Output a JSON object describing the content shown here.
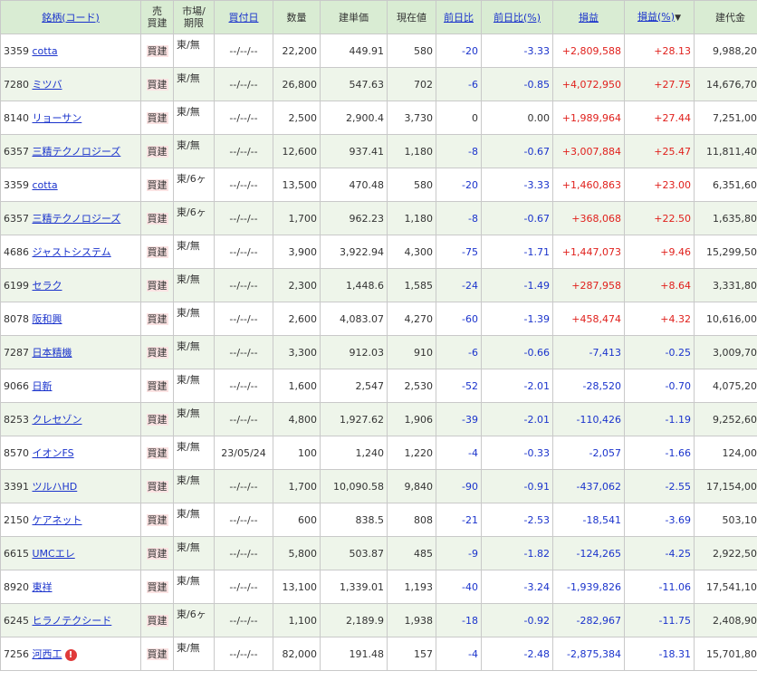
{
  "headers": {
    "name_code": "銘柄(コード)",
    "sell_buy_line1": "売",
    "sell_buy_line2": "買建",
    "market_line1": "市場/",
    "market_line2": "期限",
    "buy_date": "買付日",
    "quantity": "数量",
    "unit_price": "建単価",
    "current_price": "現在値",
    "day_change": "前日比",
    "day_change_pct": "前日比(%)",
    "profit": "損益",
    "profit_pct": "損益(%)",
    "sort_arrow": "▼",
    "position_value": "建代金"
  },
  "rows": [
    {
      "code": "3359",
      "name": "cotta",
      "type": "買建",
      "market": "東/無",
      "date": "--/--/--",
      "qty": "22,200",
      "unit": "449.91",
      "price": "580",
      "chg": "-20",
      "chg_pct": "-3.33",
      "pl": "+2,809,588",
      "pl_pct": "+28.13",
      "value": "9,988,200"
    },
    {
      "code": "7280",
      "name": "ミツバ",
      "type": "買建",
      "market": "東/無",
      "date": "--/--/--",
      "qty": "26,800",
      "unit": "547.63",
      "price": "702",
      "chg": "-6",
      "chg_pct": "-0.85",
      "pl": "+4,072,950",
      "pl_pct": "+27.75",
      "value": "14,676,700"
    },
    {
      "code": "8140",
      "name": "リョーサン",
      "type": "買建",
      "market": "東/無",
      "date": "--/--/--",
      "qty": "2,500",
      "unit": "2,900.4",
      "price": "3,730",
      "chg": "0",
      "chg_pct": "0.00",
      "pl": "+1,989,964",
      "pl_pct": "+27.44",
      "value": "7,251,000"
    },
    {
      "code": "6357",
      "name": "三精テクノロジーズ",
      "type": "買建",
      "market": "東/無",
      "date": "--/--/--",
      "qty": "12,600",
      "unit": "937.41",
      "price": "1,180",
      "chg": "-8",
      "chg_pct": "-0.67",
      "pl": "+3,007,884",
      "pl_pct": "+25.47",
      "value": "11,811,400"
    },
    {
      "code": "3359",
      "name": "cotta",
      "type": "買建",
      "market": "東/6ヶ",
      "date": "--/--/--",
      "qty": "13,500",
      "unit": "470.48",
      "price": "580",
      "chg": "-20",
      "chg_pct": "-3.33",
      "pl": "+1,460,863",
      "pl_pct": "+23.00",
      "value": "6,351,600"
    },
    {
      "code": "6357",
      "name": "三精テクノロジーズ",
      "type": "買建",
      "market": "東/6ヶ",
      "date": "--/--/--",
      "qty": "1,700",
      "unit": "962.23",
      "price": "1,180",
      "chg": "-8",
      "chg_pct": "-0.67",
      "pl": "+368,068",
      "pl_pct": "+22.50",
      "value": "1,635,800"
    },
    {
      "code": "4686",
      "name": "ジャストシステム",
      "type": "買建",
      "market": "東/無",
      "date": "--/--/--",
      "qty": "3,900",
      "unit": "3,922.94",
      "price": "4,300",
      "chg": "-75",
      "chg_pct": "-1.71",
      "pl": "+1,447,073",
      "pl_pct": "+9.46",
      "value": "15,299,500"
    },
    {
      "code": "6199",
      "name": "セラク",
      "type": "買建",
      "market": "東/無",
      "date": "--/--/--",
      "qty": "2,300",
      "unit": "1,448.6",
      "price": "1,585",
      "chg": "-24",
      "chg_pct": "-1.49",
      "pl": "+287,958",
      "pl_pct": "+8.64",
      "value": "3,331,800"
    },
    {
      "code": "8078",
      "name": "阪和興",
      "type": "買建",
      "market": "東/無",
      "date": "--/--/--",
      "qty": "2,600",
      "unit": "4,083.07",
      "price": "4,270",
      "chg": "-60",
      "chg_pct": "-1.39",
      "pl": "+458,474",
      "pl_pct": "+4.32",
      "value": "10,616,000"
    },
    {
      "code": "7287",
      "name": "日本精機",
      "type": "買建",
      "market": "東/無",
      "date": "--/--/--",
      "qty": "3,300",
      "unit": "912.03",
      "price": "910",
      "chg": "-6",
      "chg_pct": "-0.66",
      "pl": "-7,413",
      "pl_pct": "-0.25",
      "value": "3,009,700"
    },
    {
      "code": "9066",
      "name": "日新",
      "type": "買建",
      "market": "東/無",
      "date": "--/--/--",
      "qty": "1,600",
      "unit": "2,547",
      "price": "2,530",
      "chg": "-52",
      "chg_pct": "-2.01",
      "pl": "-28,520",
      "pl_pct": "-0.70",
      "value": "4,075,200"
    },
    {
      "code": "8253",
      "name": "クレセゾン",
      "type": "買建",
      "market": "東/無",
      "date": "--/--/--",
      "qty": "4,800",
      "unit": "1,927.62",
      "price": "1,906",
      "chg": "-39",
      "chg_pct": "-2.01",
      "pl": "-110,426",
      "pl_pct": "-1.19",
      "value": "9,252,600"
    },
    {
      "code": "8570",
      "name": "イオンFS",
      "type": "買建",
      "market": "東/無",
      "date": "23/05/24",
      "qty": "100",
      "unit": "1,240",
      "price": "1,220",
      "chg": "-4",
      "chg_pct": "-0.33",
      "pl": "-2,057",
      "pl_pct": "-1.66",
      "value": "124,000"
    },
    {
      "code": "3391",
      "name": "ツルハHD",
      "type": "買建",
      "market": "東/無",
      "date": "--/--/--",
      "qty": "1,700",
      "unit": "10,090.58",
      "price": "9,840",
      "chg": "-90",
      "chg_pct": "-0.91",
      "pl": "-437,062",
      "pl_pct": "-2.55",
      "value": "17,154,000"
    },
    {
      "code": "2150",
      "name": "ケアネット",
      "type": "買建",
      "market": "東/無",
      "date": "--/--/--",
      "qty": "600",
      "unit": "838.5",
      "price": "808",
      "chg": "-21",
      "chg_pct": "-2.53",
      "pl": "-18,541",
      "pl_pct": "-3.69",
      "value": "503,100"
    },
    {
      "code": "6615",
      "name": "UMCエレ",
      "type": "買建",
      "market": "東/無",
      "date": "--/--/--",
      "qty": "5,800",
      "unit": "503.87",
      "price": "485",
      "chg": "-9",
      "chg_pct": "-1.82",
      "pl": "-124,265",
      "pl_pct": "-4.25",
      "value": "2,922,500"
    },
    {
      "code": "8920",
      "name": "東祥",
      "type": "買建",
      "market": "東/無",
      "date": "--/--/--",
      "qty": "13,100",
      "unit": "1,339.01",
      "price": "1,193",
      "chg": "-40",
      "chg_pct": "-3.24",
      "pl": "-1,939,826",
      "pl_pct": "-11.06",
      "value": "17,541,100"
    },
    {
      "code": "6245",
      "name": "ヒラノテクシード",
      "type": "買建",
      "market": "東/6ヶ",
      "date": "--/--/--",
      "qty": "1,100",
      "unit": "2,189.9",
      "price": "1,938",
      "chg": "-18",
      "chg_pct": "-0.92",
      "pl": "-282,967",
      "pl_pct": "-11.75",
      "value": "2,408,900"
    },
    {
      "code": "7256",
      "name": "河西工",
      "type": "買建",
      "market": "東/無",
      "date": "--/--/--",
      "qty": "82,000",
      "unit": "191.48",
      "price": "157",
      "chg": "-4",
      "chg_pct": "-2.48",
      "pl": "-2,875,384",
      "pl_pct": "-18.31",
      "value": "15,701,800",
      "alert_icon": "!"
    }
  ],
  "colors": {
    "header_bg": "#d9ecd3",
    "even_row_bg": "#eef5ea",
    "positive": "#e0201c",
    "negative": "#1a33cc",
    "link": "#1a33cc",
    "badge_bg": "#fbe3e3"
  }
}
